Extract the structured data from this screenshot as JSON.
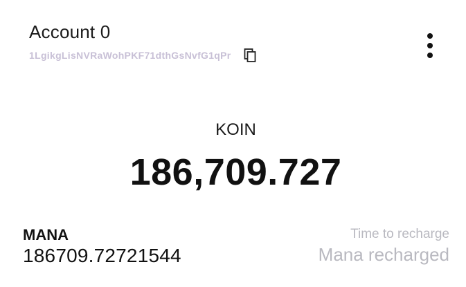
{
  "account": {
    "name": "Account 0",
    "address": "1LgikgLisNVRaWohPKF71dthGsNvfG1qPr",
    "copy_icon": "copy-icon",
    "menu_icon": "more-vertical-icon"
  },
  "balance": {
    "symbol": "KOIN",
    "amount": "186,709.727"
  },
  "mana": {
    "label": "MANA",
    "value": "186709.72721544",
    "recharge_label": "Time to recharge",
    "recharge_status": "Mana recharged"
  },
  "colors": {
    "address": "#c8c0d6",
    "muted": "#b9b9c0",
    "text": "#111111"
  }
}
